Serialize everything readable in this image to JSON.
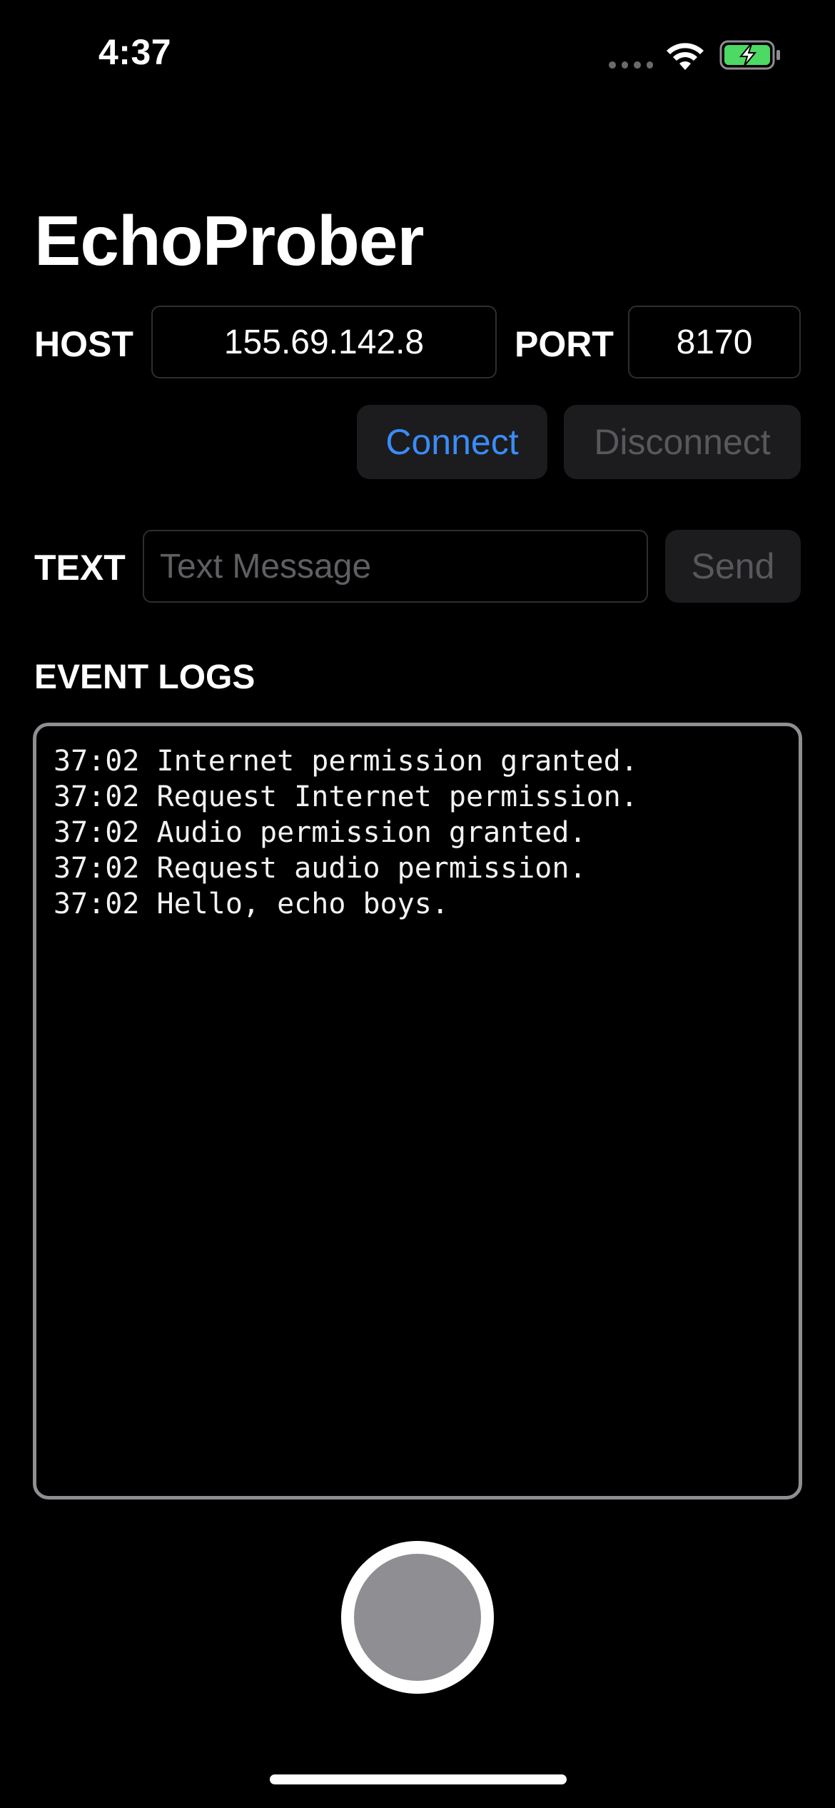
{
  "status_bar": {
    "time": "4:37",
    "signal_icon": "signal-dots-icon",
    "wifi_icon": "wifi-icon",
    "battery_icon": "battery-charging-icon",
    "battery_color": "#4cd964"
  },
  "app": {
    "title": "EchoProber"
  },
  "connection": {
    "host_label": "HOST",
    "host_value": "155.69.142.8",
    "port_label": "PORT",
    "port_value": "8170",
    "connect_label": "Connect",
    "disconnect_label": "Disconnect"
  },
  "message": {
    "text_label": "TEXT",
    "placeholder": "Text Message",
    "value": "",
    "send_label": "Send"
  },
  "logs": {
    "title": "EVENT LOGS",
    "entries": [
      "37:02 Internet permission granted.",
      "37:02 Request Internet permission.",
      "37:02 Audio permission granted.",
      "37:02 Request audio permission.",
      "37:02 Hello, echo boys."
    ]
  },
  "colors": {
    "accent": "#3a8cf7",
    "disabled_text": "#58585c",
    "button_bg": "#1c1c1e",
    "log_border": "#8e8e93"
  }
}
